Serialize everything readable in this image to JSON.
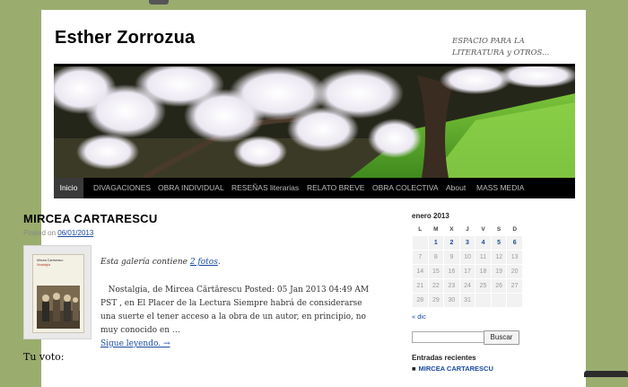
{
  "site": {
    "title": "Esther Zorrozua",
    "description": "ESPACIO PARA LA LITERATURA y OTROS..."
  },
  "nav": [
    {
      "label": "Inicio",
      "current": true
    },
    {
      "label": "DIVAGACIONES"
    },
    {
      "label": "OBRA INDIVIDUAL"
    },
    {
      "label": "RESEÑAS literarias"
    },
    {
      "label": "RELATO BREVE"
    },
    {
      "label": "OBRA COLECTIVA"
    },
    {
      "label": "About"
    },
    {
      "label": "MASS MEDIA"
    }
  ],
  "post": {
    "title": "MIRCEA CARTARESCU",
    "meta_prefix": "Posted on ",
    "date": "06/01/2013",
    "gallery_prefix": "Esta galería contiene ",
    "gallery_link": "2 fotos",
    "gallery_suffix": ".",
    "excerpt": "Nostalgia, de Mircea Cărtărescu Posted: 05 Jan 2013 04:49 AM PST , en El Placer de la Lectura Siempre habrá de considerarse una suerte el tener acceso a la obra de un autor, en principio, no muy conocido en …",
    "read_more": "Sigue leyendo. →",
    "vote_label": "Tu voto:",
    "book": {
      "author": "Mircea Cartarescu",
      "title": "Nostalgia"
    }
  },
  "calendar": {
    "caption": "enero 2013",
    "weekdays": [
      "L",
      "M",
      "X",
      "J",
      "V",
      "S",
      "D"
    ],
    "weeks": [
      [
        "",
        "1",
        "2",
        "3",
        "4",
        "5",
        "6"
      ],
      [
        "7",
        "8",
        "9",
        "10",
        "11",
        "12",
        "13"
      ],
      [
        "14",
        "15",
        "16",
        "17",
        "18",
        "19",
        "20"
      ],
      [
        "21",
        "22",
        "23",
        "24",
        "25",
        "26",
        "27"
      ],
      [
        "28",
        "29",
        "30",
        "31",
        "",
        "",
        ""
      ]
    ],
    "linked_days": [
      "1",
      "2",
      "3",
      "4",
      "5",
      "6"
    ],
    "prev_link": "« dic"
  },
  "search": {
    "button_label": "Buscar",
    "value": ""
  },
  "recent": {
    "title": "Entradas recientes",
    "items": [
      "MIRCEA CARTARESCU"
    ]
  },
  "colors": {
    "link": "#1b4ba0",
    "background": "#9aad6e",
    "nav_bar": "#000000"
  }
}
